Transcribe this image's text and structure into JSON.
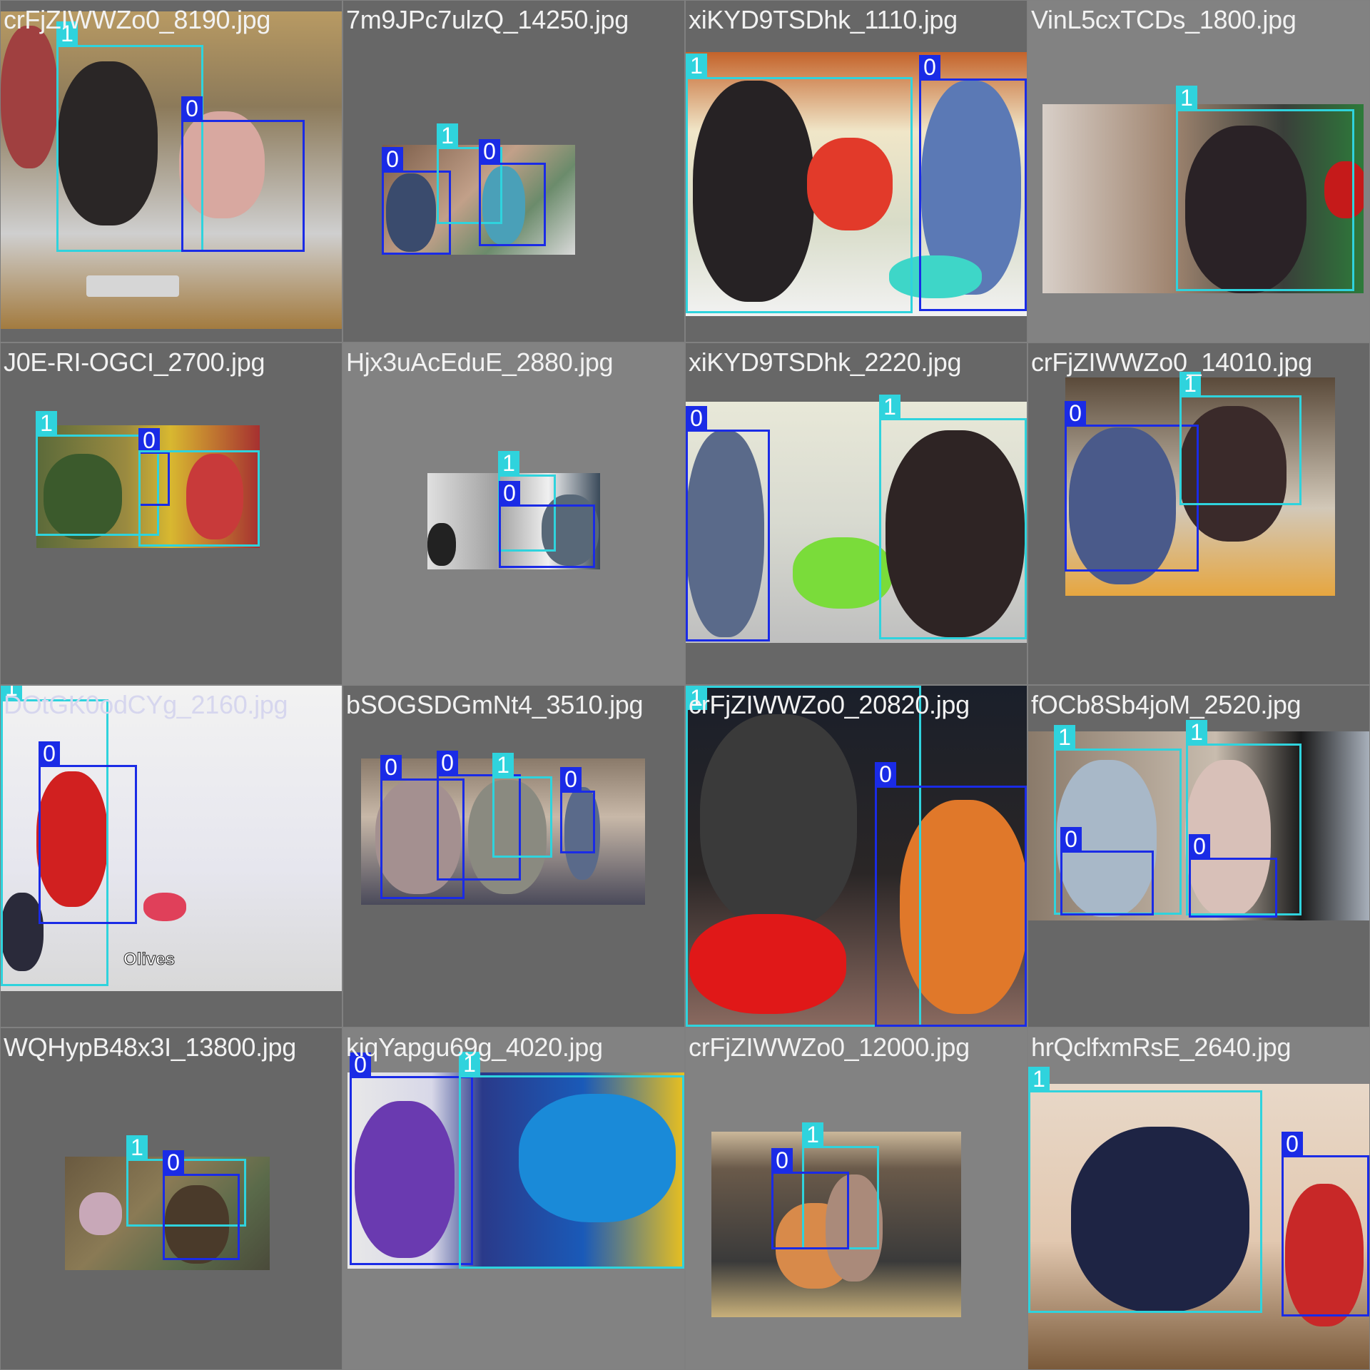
{
  "tiles": [
    {
      "filename": "crFjZIWWZo0_8190.jpg",
      "labels": [
        "1",
        "0"
      ]
    },
    {
      "filename": "7m9JPc7ulzQ_14250.jpg",
      "labels": [
        "0",
        "1",
        "0"
      ]
    },
    {
      "filename": "xiKYD9TSDhk_1110.jpg",
      "labels": [
        "1",
        "0"
      ]
    },
    {
      "filename": "VinL5cxTCDs_1800.jpg",
      "labels": [
        "1"
      ]
    },
    {
      "filename": "J0E-RI-OGCI_2700.jpg",
      "labels": [
        "1",
        "0"
      ]
    },
    {
      "filename": "Hjx3uAcEduE_2880.jpg",
      "labels": [
        "1",
        "0"
      ]
    },
    {
      "filename": "xiKYD9TSDhk_2220.jpg",
      "labels": [
        "0",
        "1"
      ]
    },
    {
      "filename": "crFjZIWWZo0_14010.jpg",
      "labels": [
        "0",
        "1"
      ]
    },
    {
      "filename": "DOtGK0odCYg_2160.jpg",
      "labels": [
        "1",
        "0"
      ],
      "caption": "Olives"
    },
    {
      "filename": "bSOGSDGmNt4_3510.jpg",
      "labels": [
        "0",
        "0",
        "1",
        "0"
      ]
    },
    {
      "filename": "crFjZIWWZo0_20820.jpg",
      "labels": [
        "1",
        "0"
      ]
    },
    {
      "filename": "fOCb8Sb4joM_2520.jpg",
      "labels": [
        "1",
        "1",
        "0",
        "0"
      ]
    },
    {
      "filename": "WQHypB48x3I_13800.jpg",
      "labels": [
        "1",
        "0"
      ]
    },
    {
      "filename": "kiqYapgu69g_4020.jpg",
      "labels": [
        "0",
        "1"
      ]
    },
    {
      "filename": "crFjZIWWZo0_12000.jpg",
      "labels": [
        "1",
        "0"
      ]
    },
    {
      "filename": "hrQclfxmRsE_2640.jpg",
      "labels": [
        "1",
        "0"
      ]
    }
  ],
  "colors": {
    "class_0": "#1a2be6",
    "class_1": "#2fd3dd",
    "background": "#808080"
  }
}
